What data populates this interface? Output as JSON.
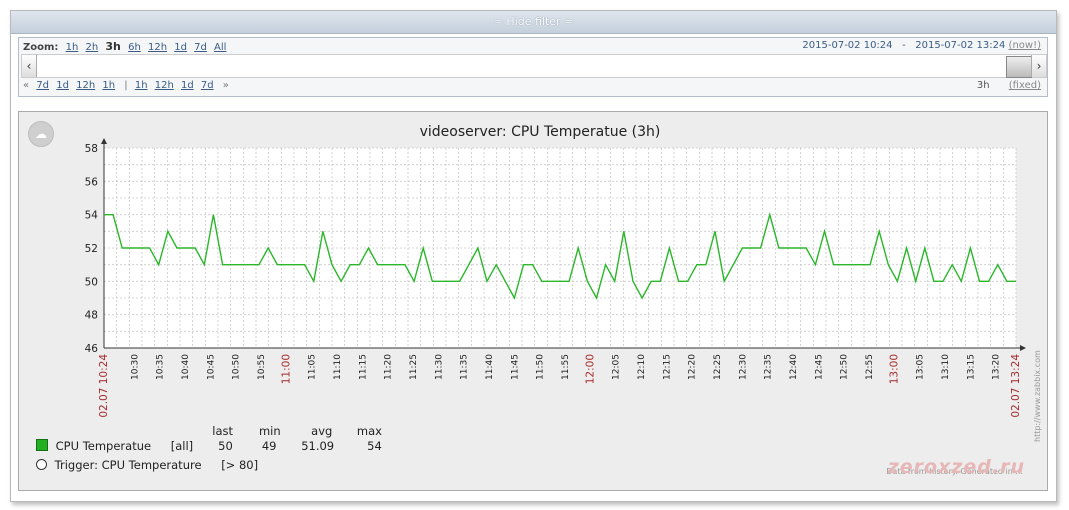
{
  "filter_bar": {
    "label": "≈ Hide filter ≈"
  },
  "timeline": {
    "zoom_label": "Zoom:",
    "zoom_links": [
      "1h",
      "2h",
      "3h",
      "6h",
      "12h",
      "1d",
      "7d",
      "All"
    ],
    "zoom_current": "3h",
    "period_from": "2015-07-02 10:24",
    "period_sep": "-",
    "period_to": "2015-07-02 13:24",
    "now_label": "(now!)",
    "scroll_left": "‹",
    "scroll_right": "›",
    "nav_back": [
      "«",
      "7d",
      "1d",
      "12h",
      "1h"
    ],
    "nav_sep": "|",
    "nav_fwd": [
      "1h",
      "12h",
      "1d",
      "7d",
      "»"
    ],
    "period_length": "3h",
    "fixed_label": "(fixed)"
  },
  "colors": {
    "series": "#2ab72a",
    "grid": "#c8c8c8",
    "red_label": "#a52a2a"
  },
  "chart_data": {
    "type": "line",
    "title": "videoserver: CPU Temperatue (3h)",
    "ylim": [
      46,
      58
    ],
    "yticks": [
      46,
      48,
      50,
      52,
      54,
      56,
      58
    ],
    "x_start_label": "02.07 10:24",
    "x_end_label": "02.07 13:24",
    "x_tick_labels": [
      "10:30",
      "10:35",
      "10:40",
      "10:45",
      "10:50",
      "10:55",
      "11:00",
      "11:05",
      "11:10",
      "11:15",
      "11:20",
      "11:25",
      "11:30",
      "11:35",
      "11:40",
      "11:45",
      "11:50",
      "11:55",
      "12:00",
      "12:05",
      "12:10",
      "12:15",
      "12:20",
      "12:25",
      "12:30",
      "12:35",
      "12:40",
      "12:45",
      "12:50",
      "12:55",
      "13:00",
      "13:05",
      "13:10",
      "13:15",
      "13:20"
    ],
    "red_ticks": [
      "11:00",
      "12:00",
      "13:00"
    ],
    "series": [
      {
        "name": "CPU Temperatue",
        "values": [
          54,
          54,
          52,
          52,
          52,
          52,
          51,
          53,
          52,
          52,
          52,
          51,
          54,
          51,
          51,
          51,
          51,
          51,
          52,
          51,
          51,
          51,
          51,
          50,
          53,
          51,
          50,
          51,
          51,
          52,
          51,
          51,
          51,
          51,
          50,
          52,
          50,
          50,
          50,
          50,
          51,
          52,
          50,
          51,
          50,
          49,
          51,
          51,
          50,
          50,
          50,
          50,
          52,
          50,
          49,
          51,
          50,
          53,
          50,
          49,
          50,
          50,
          52,
          50,
          50,
          51,
          51,
          53,
          50,
          51,
          52,
          52,
          52,
          54,
          52,
          52,
          52,
          52,
          51,
          53,
          51,
          51,
          51,
          51,
          51,
          53,
          51,
          50,
          52,
          50,
          52,
          50,
          50,
          51,
          50,
          52,
          50,
          50,
          51,
          50,
          50
        ]
      }
    ],
    "legend": {
      "headers": [
        "last",
        "min",
        "avg",
        "max"
      ],
      "series_name": "CPU Temperatue",
      "series_scope": "[all]",
      "last": "50",
      "min": "49",
      "avg": "51.09",
      "max": "54",
      "trigger_label": "Trigger: CPU Temperature",
      "trigger_value": "[> 80]"
    },
    "side_note": "http://www.zabbix.com"
  },
  "footer": {
    "data_note": "Data from history. Generated in ...",
    "watermark": "zeroxzed.ru"
  }
}
